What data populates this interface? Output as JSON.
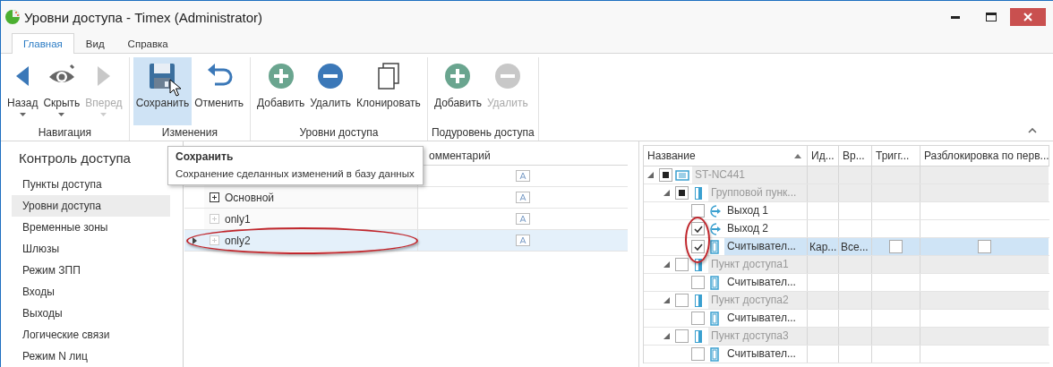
{
  "window": {
    "title": "Уровни доступа - Timex (Administrator)"
  },
  "ribbon_tabs": [
    {
      "label": "Главная",
      "selected": true
    },
    {
      "label": "Вид",
      "selected": false
    },
    {
      "label": "Справка",
      "selected": false
    }
  ],
  "ribbon_groups": [
    {
      "label": "Навигация",
      "buttons": [
        {
          "label": "Назад",
          "kind": "back",
          "disabled": false,
          "dropdown": true,
          "hovered": false
        },
        {
          "label": "Скрыть",
          "kind": "hide",
          "disabled": false,
          "dropdown": true,
          "hovered": false
        },
        {
          "label": "Вперед",
          "kind": "forward",
          "disabled": true,
          "dropdown": true,
          "hovered": false
        }
      ]
    },
    {
      "label": "Изменения",
      "buttons": [
        {
          "label": "Сохранить",
          "kind": "save",
          "disabled": false,
          "dropdown": false,
          "hovered": true
        },
        {
          "label": "Отменить",
          "kind": "undo",
          "disabled": false,
          "dropdown": false,
          "hovered": false
        }
      ]
    },
    {
      "label": "Уровни доступа",
      "buttons": [
        {
          "label": "Добавить",
          "kind": "add",
          "disabled": false,
          "dropdown": false,
          "hovered": false
        },
        {
          "label": "Удалить",
          "kind": "delete",
          "disabled": false,
          "dropdown": false,
          "hovered": false
        },
        {
          "label": "Клонировать",
          "kind": "clone",
          "disabled": false,
          "dropdown": false,
          "hovered": false
        }
      ]
    },
    {
      "label": "Подуровень доступа",
      "buttons": [
        {
          "label": "Добавить",
          "kind": "add",
          "disabled": false,
          "dropdown": false,
          "hovered": false
        },
        {
          "label": "Удалить",
          "kind": "delete",
          "disabled": true,
          "dropdown": false,
          "hovered": false
        }
      ]
    }
  ],
  "tooltip": {
    "title": "Сохранить",
    "text": "Сохранение сделанных изменений в базу данных"
  },
  "sidebar": {
    "title": "Контроль доступа",
    "items": [
      {
        "label": "Пункты доступа",
        "selected": false
      },
      {
        "label": "Уровни доступа",
        "selected": true
      },
      {
        "label": "Временные зоны",
        "selected": false
      },
      {
        "label": "Шлюзы",
        "selected": false
      },
      {
        "label": "Режим ЗПП",
        "selected": false
      },
      {
        "label": "Входы",
        "selected": false
      },
      {
        "label": "Выходы",
        "selected": false
      },
      {
        "label": "Логические связи",
        "selected": false
      },
      {
        "label": "Режим N лиц",
        "selected": false
      }
    ]
  },
  "levels_grid": {
    "comment_header": "омментарий",
    "rows": [
      {
        "selected": false
      },
      {
        "name": "Основной",
        "has_children": true,
        "selected": false
      },
      {
        "name": "only1",
        "has_children": false,
        "selected": false
      },
      {
        "name": "only2",
        "has_children": false,
        "selected": true,
        "circled": true
      }
    ]
  },
  "devices_tree": {
    "columns": [
      {
        "label": "Название",
        "sorted": true
      },
      {
        "label": "Ид..."
      },
      {
        "label": "Вр..."
      },
      {
        "label": "Тригг..."
      },
      {
        "label": "Разблокировка по перв..."
      }
    ],
    "rows": [
      {
        "name": "ST-NC441",
        "kind": "controller",
        "checked": false,
        "indeterminate": true,
        "expanded": true,
        "selected": false,
        "children": [
          {
            "name": "Групповой пунк...",
            "kind": "access-point",
            "checked": false,
            "indeterminate": true,
            "expanded": true,
            "selected": false,
            "children": [
              {
                "name": "Выход 1",
                "kind": "exit",
                "checked": false,
                "selected": false
              },
              {
                "name": "Выход 2",
                "kind": "exit",
                "checked": true,
                "selected": false,
                "circled": true
              },
              {
                "name": "Считывател...",
                "kind": "reader",
                "checked": true,
                "selected": true,
                "circled": true,
                "cells": [
                  {
                    "kind": "text",
                    "text": "Кар..."
                  },
                  {
                    "kind": "text",
                    "text": "Все..."
                  },
                  {
                    "kind": "checkbox",
                    "checked": false
                  },
                  {
                    "kind": "checkbox",
                    "checked": false
                  }
                ]
              }
            ]
          },
          {
            "name": "Пункт доступа1",
            "kind": "access-point",
            "checked": false,
            "expanded": true,
            "selected": false,
            "children": [
              {
                "name": "Считывател...",
                "kind": "reader",
                "checked": false,
                "selected": false
              }
            ]
          },
          {
            "name": "Пункт доступа2",
            "kind": "access-point",
            "checked": false,
            "expanded": true,
            "selected": false,
            "children": [
              {
                "name": "Считывател...",
                "kind": "reader",
                "checked": false,
                "selected": false
              }
            ]
          },
          {
            "name": "Пункт доступа3",
            "kind": "access-point",
            "checked": false,
            "expanded": true,
            "selected": false,
            "children": [
              {
                "name": "Считывател...",
                "kind": "reader",
                "checked": false,
                "selected": false
              }
            ]
          }
        ]
      }
    ]
  }
}
